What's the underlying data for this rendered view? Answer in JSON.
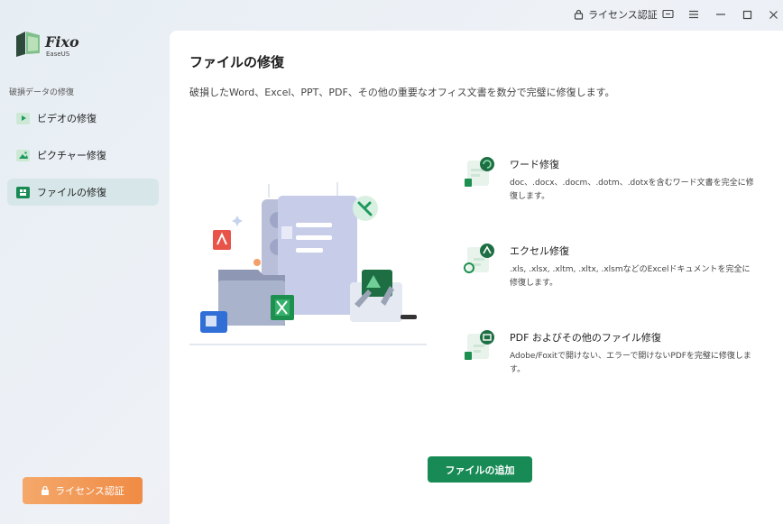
{
  "titlebar": {
    "license_label": "ライセンス認証",
    "icons": [
      "lock-icon",
      "feedback-icon",
      "menu-icon",
      "minimize-icon",
      "maximize-icon",
      "close-icon"
    ]
  },
  "logo": {
    "name": "Fixo",
    "sub": "EaseUS"
  },
  "sidebar": {
    "section_label": "破損データの修復",
    "items": [
      {
        "label": "ビデオの修復",
        "icon": "video-play-icon",
        "active": false
      },
      {
        "label": "ピクチャー修復",
        "icon": "picture-icon",
        "active": false
      },
      {
        "label": "ファイルの修復",
        "icon": "file-repair-icon",
        "active": true
      }
    ],
    "license_button": "ライセンス認証"
  },
  "main": {
    "title": "ファイルの修復",
    "description": "破損したWord、Excel、PPT、PDF、その他の重要なオフィス文書を数分で完璧に修復します。",
    "features": [
      {
        "title": "ワード修復",
        "desc": "doc、.docx、.docm、.dotm、.dotxを含むワード文書を完全に修復します。",
        "icon": "word-repair-icon"
      },
      {
        "title": "エクセル修復",
        "desc": ".xls, .xlsx, .xltm, .xltx, .xlsmなどのExcelドキュメントを完全に修復します。",
        "icon": "excel-repair-icon"
      },
      {
        "title": "PDF およびその他のファイル修復",
        "desc": "Adobe/Foxitで開けない、エラーで開けないPDFを完璧に修復します。",
        "icon": "pdf-repair-icon"
      }
    ],
    "add_button": "ファイルの追加"
  },
  "colors": {
    "accent": "#178a55",
    "license": "#ef8b45",
    "active_bg": "#d7e7e9"
  }
}
